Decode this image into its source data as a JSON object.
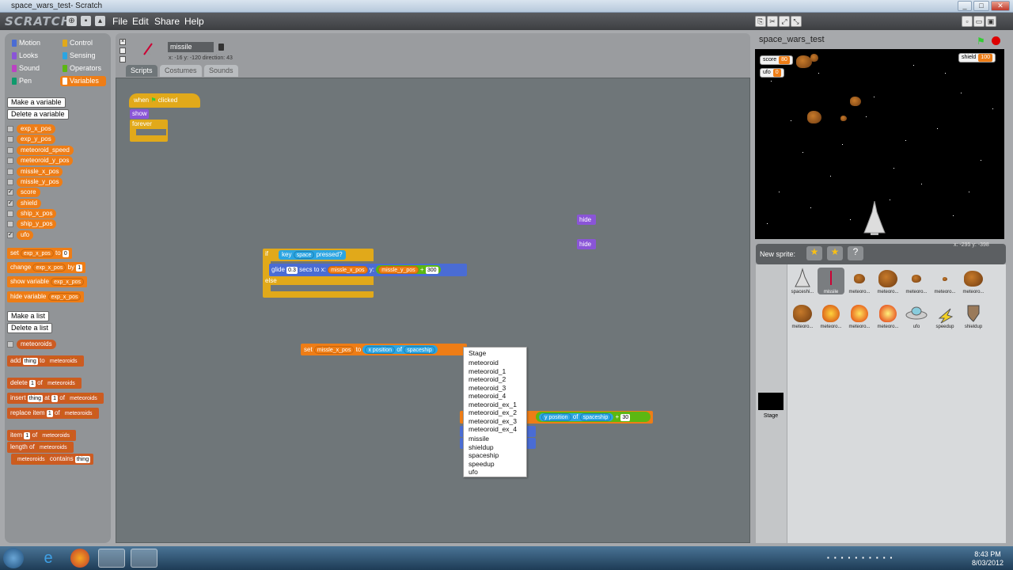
{
  "window": {
    "title": "space_wars_test- Scratch"
  },
  "menubar": {
    "logo": "SCRATCH",
    "menus": [
      "File",
      "Edit",
      "Share",
      "Help"
    ]
  },
  "palette": {
    "categories": [
      {
        "label": "Motion",
        "color": "#4a6cd4"
      },
      {
        "label": "Control",
        "color": "#e1a91a"
      },
      {
        "label": "Looks",
        "color": "#8a55d7"
      },
      {
        "label": "Sensing",
        "color": "#2ca5e2"
      },
      {
        "label": "Sound",
        "color": "#bb42c3"
      },
      {
        "label": "Operators",
        "color": "#5cb712"
      },
      {
        "label": "Pen",
        "color": "#0e9a6c"
      },
      {
        "label": "Variables",
        "color": "#ee7d16"
      }
    ],
    "selected_category": "Variables",
    "make_variable": "Make a variable",
    "delete_variable": "Delete a variable",
    "variables": [
      {
        "name": "exp_x_pos",
        "checked": false
      },
      {
        "name": "exp_y_pos",
        "checked": false
      },
      {
        "name": "meteoroid_speed",
        "checked": false
      },
      {
        "name": "meteoroid_y_pos",
        "checked": false
      },
      {
        "name": "missle_x_pos",
        "checked": false
      },
      {
        "name": "missle_y_pos",
        "checked": false
      },
      {
        "name": "score",
        "checked": true
      },
      {
        "name": "shield",
        "checked": true
      },
      {
        "name": "ship_x_pos",
        "checked": false
      },
      {
        "name": "ship_y_pos",
        "checked": false
      },
      {
        "name": "ufo",
        "checked": true
      }
    ],
    "blocks": {
      "set": "set",
      "set_var": "exp_x_pos",
      "to": "to",
      "set_val": "0",
      "change": "change",
      "change_var": "exp_x_pos",
      "by": "by",
      "change_val": "1",
      "show_variable": "show variable",
      "show_var": "exp_x_pos",
      "hide_variable": "hide variable",
      "hide_var": "exp_x_pos"
    },
    "make_list": "Make a list",
    "delete_list": "Delete a list",
    "list_name": "meteoroids",
    "list_blocks": {
      "add": "add",
      "thing": "thing",
      "to": "to",
      "delete": "delete",
      "of": "of",
      "one": "1",
      "insert": "insert",
      "at": "at",
      "replace": "replace item",
      "with": "with",
      "item": "item",
      "length": "length of",
      "contains": "contains"
    }
  },
  "sprite_header": {
    "name": "missile",
    "info": "x: -16   y: -120  direction: 43",
    "tabs": [
      "Scripts",
      "Costumes",
      "Sounds"
    ],
    "selected_tab": "Scripts"
  },
  "scripts": {
    "when_flag": "when",
    "clicked": "clicked",
    "show": "show",
    "forever": "forever",
    "hide1": "hide",
    "hide2": "hide",
    "if_label": "if",
    "key": "key",
    "key_name": "space",
    "pressed": "pressed?",
    "glide": "glide",
    "glide_secs": "0.3",
    "secs_to_x": "secs to x:",
    "glide_x": "missle_x_pos",
    "y_label": "y:",
    "glide_y": "missle_y_pos",
    "plus": "+",
    "glide_add": "300",
    "else": "else",
    "set": "set",
    "set_var": "missle_x_pos",
    "to": "to",
    "xpos": "x position",
    "of": "of",
    "sprite": "spaceship",
    "ypos": "y position",
    "ypos_add": "30"
  },
  "dropdown": {
    "items": [
      "Stage",
      "meteoroid",
      "meteoroid_1",
      "meteoroid_2",
      "meteoroid_3",
      "meteoroid_4",
      "meteoroid_ex_1",
      "meteoroid_ex_2",
      "meteoroid_ex_3",
      "meteoroid_ex_4",
      "missile",
      "shieldup",
      "spaceship",
      "speedup",
      "ufo"
    ]
  },
  "stage": {
    "title": "space_wars_test",
    "monitors": [
      {
        "label": "score",
        "value": "80"
      },
      {
        "label": "ufo",
        "value": "0"
      },
      {
        "label": "shield",
        "value": "100"
      }
    ],
    "mouse_readout": "x: -295   y: -398"
  },
  "sprites_panel": {
    "new_sprite": "New sprite:",
    "stage_label": "Stage",
    "sprites": [
      "spaceshi...",
      "missile",
      "meteoro...",
      "meteoro...",
      "meteoro...",
      "meteoro...",
      "meteoro...",
      "meteoro...",
      "meteoro...",
      "meteoro...",
      "meteoro...",
      "ufo",
      "speedup",
      "shieldup"
    ],
    "selected": "missile"
  },
  "taskbar": {
    "time": "8:43 PM",
    "date": "8/03/2012"
  }
}
